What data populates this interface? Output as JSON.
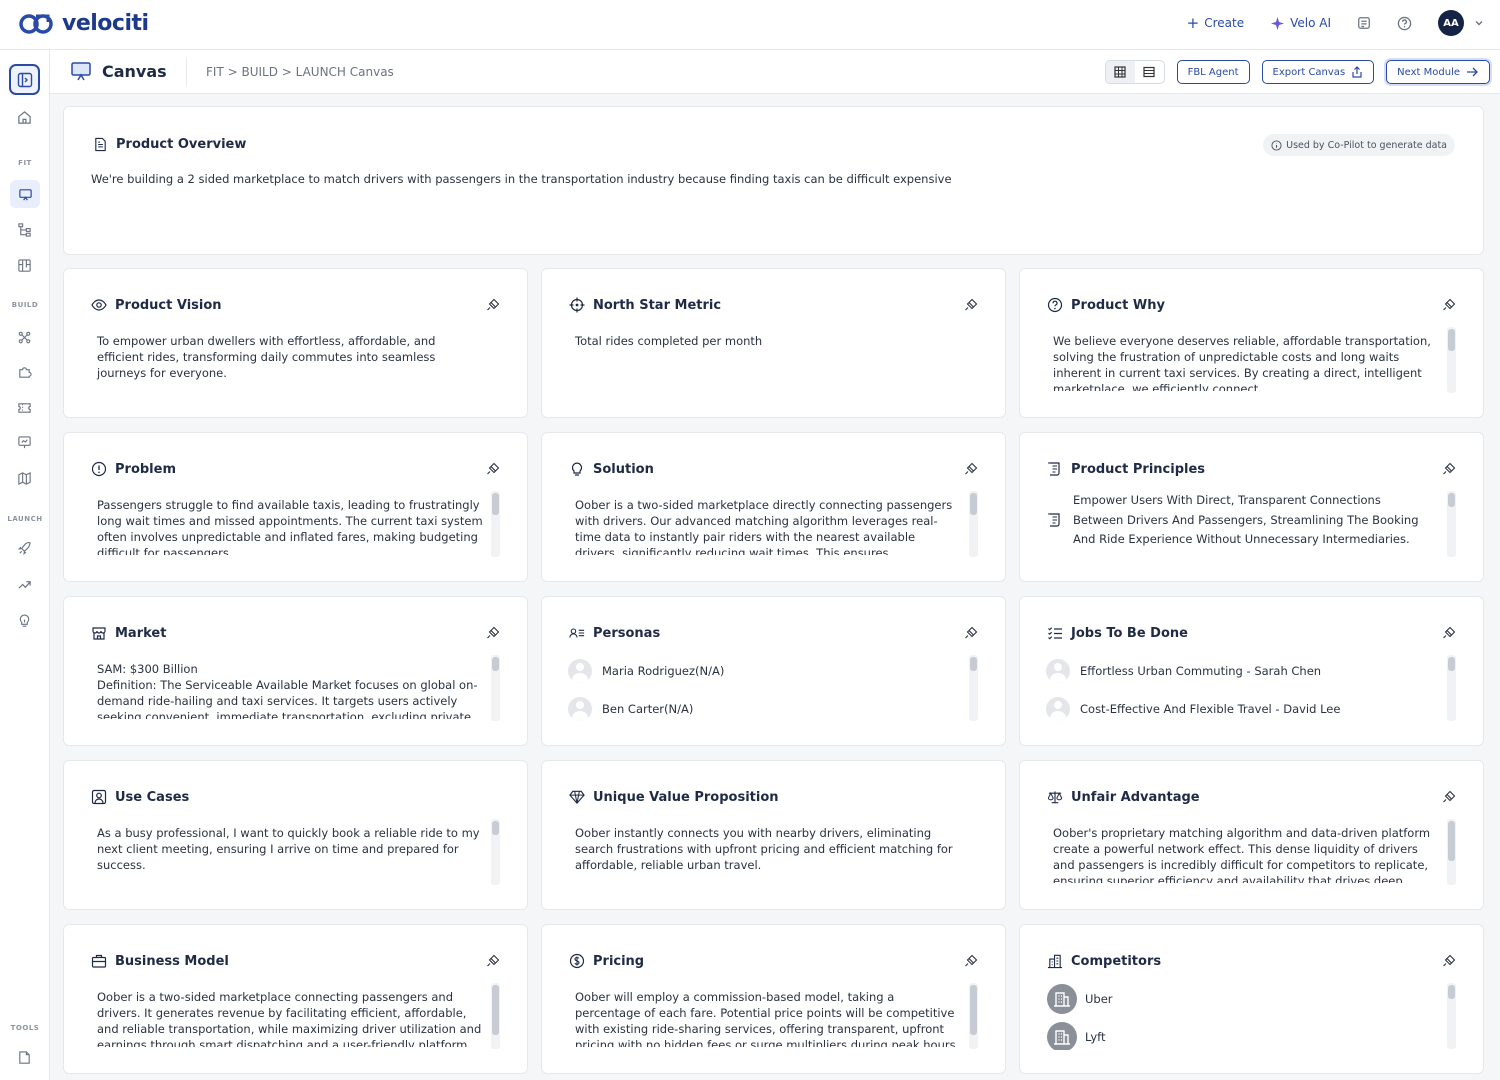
{
  "app": {
    "name": "velociti"
  },
  "topbar": {
    "create_label": "Create",
    "ai_label": "Velo AI",
    "avatar_initials": "AA"
  },
  "sidebar": {
    "sections": {
      "fit": "FIT",
      "build": "BUILD",
      "launch": "LAUNCH",
      "tools": "TOOLS"
    }
  },
  "header": {
    "title": "Canvas",
    "breadcrumb": "FIT > BUILD > LAUNCH Canvas",
    "fbl_agent_label": "FBL Agent",
    "export_label": "Export Canvas",
    "next_label": "Next Module"
  },
  "overview": {
    "title": "Product Overview",
    "badge": "Used by Co-Pilot to generate data",
    "text": "We're building a 2 sided marketplace to match drivers with passengers in the transportation industry because finding taxis can be difficult expensive"
  },
  "cards": {
    "vision": {
      "title": "Product Vision",
      "text": "To empower urban dwellers with effortless, affordable, and efficient rides, transforming daily commutes into seamless journeys for everyone."
    },
    "north_star": {
      "title": "North Star Metric",
      "text": "Total rides completed per month"
    },
    "why": {
      "title": "Product Why",
      "text": "We believe everyone deserves reliable, affordable transportation, solving the frustration of unpredictable costs and long waits inherent in current taxi services. By creating a direct, intelligent marketplace, we efficiently connect"
    },
    "problem": {
      "title": "Problem",
      "text": "Passengers struggle to find available taxis, leading to frustratingly long wait times and missed appointments. The current taxi system often involves unpredictable and inflated fares, making budgeting difficult for passengers."
    },
    "solution": {
      "title": "Solution",
      "text": "Oober is a two-sided marketplace directly connecting passengers with drivers. Our advanced matching algorithm leverages real-time data to instantly pair riders with the nearest available drivers, significantly reducing wait times. This ensures transparent, upfront"
    },
    "principles": {
      "title": "Product Principles",
      "text": "Empower Users With Direct, Transparent Connections Between Drivers And Passengers, Streamlining The Booking And Ride Experience Without Unnecessary Intermediaries."
    },
    "market": {
      "title": "Market",
      "sam": "SAM: $300 Billion",
      "text": "Definition: The Serviceable Available Market focuses on global on-demand ride-hailing and taxi services. It targets users actively seeking convenient, immediate transportation, excluding private"
    },
    "personas": {
      "title": "Personas",
      "items": [
        "Maria Rodriguez(N/A)",
        "Ben Carter(N/A)"
      ]
    },
    "jobs": {
      "title": "Jobs To Be Done",
      "items": [
        "Effortless Urban Commuting - Sarah Chen",
        "Cost-Effective And Flexible Travel - David Lee"
      ]
    },
    "use_cases": {
      "title": "Use Cases",
      "text": "As a busy professional, I want to quickly book a reliable ride to my next client meeting, ensuring I arrive on time and prepared for success."
    },
    "uvp": {
      "title": "Unique Value Proposition",
      "text": "Oober instantly connects you with nearby drivers, eliminating search frustrations with upfront pricing and efficient matching for affordable, reliable urban travel."
    },
    "unfair": {
      "title": "Unfair Advantage",
      "text": "Oober's proprietary matching algorithm and data-driven platform create a powerful network effect. This dense liquidity of drivers and passengers is incredibly difficult for competitors to replicate, ensuring superior efficiency and availability that drives deep"
    },
    "business_model": {
      "title": "Business Model",
      "text": "Oober is a two-sided marketplace connecting passengers and drivers. It generates revenue by facilitating efficient, affordable, and reliable transportation, while maximizing driver utilization and earnings through smart dispatching and a user-friendly platform."
    },
    "pricing": {
      "title": "Pricing",
      "text": "Oober will employ a commission-based model, taking a percentage of each fare. Potential price points will be competitive with existing ride-sharing services, offering transparent, upfront pricing with no hidden fees or surge multipliers during peak hours."
    },
    "competitors": {
      "title": "Competitors",
      "items": [
        "Uber",
        "Lyft"
      ]
    }
  },
  "colors": {
    "brand": "#1d3a8a",
    "accent": "#2b4aa6",
    "background": "#f5f6f8"
  }
}
